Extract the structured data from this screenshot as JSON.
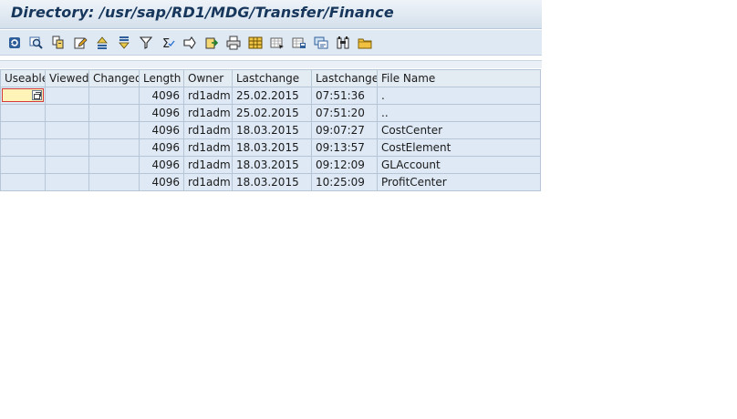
{
  "window": {
    "title": "Directory: /usr/sap/RD1/MDG/Transfer/Finance"
  },
  "toolbar": {
    "icons": [
      "refresh-icon",
      "zoom-icon",
      "copy-icon",
      "edit-icon",
      "sort-ascending-icon",
      "sort-descending-icon",
      "filter-icon",
      "total-icon",
      "subtotal-icon",
      "export-icon",
      "print-icon",
      "layout-icon",
      "select-layout-icon",
      "save-layout-icon",
      "abc-analysis-icon",
      "graphic-icon",
      "folder-icon"
    ]
  },
  "table": {
    "columns": [
      "Useable",
      "Viewed",
      "Changed",
      "Length",
      "Owner",
      "Lastchange",
      "Lastchange",
      "File Name"
    ],
    "rows": [
      {
        "useable": "",
        "viewed": "",
        "changed": "",
        "length": "4096",
        "owner": "rd1adm",
        "date": "25.02.2015",
        "time": "07:51:36",
        "file": "."
      },
      {
        "useable": "",
        "viewed": "",
        "changed": "",
        "length": "4096",
        "owner": "rd1adm",
        "date": "25.02.2015",
        "time": "07:51:20",
        "file": ".."
      },
      {
        "useable": "",
        "viewed": "",
        "changed": "",
        "length": "4096",
        "owner": "rd1adm",
        "date": "18.03.2015",
        "time": "09:07:27",
        "file": "CostCenter"
      },
      {
        "useable": "",
        "viewed": "",
        "changed": "",
        "length": "4096",
        "owner": "rd1adm",
        "date": "18.03.2015",
        "time": "09:13:57",
        "file": "CostElement"
      },
      {
        "useable": "",
        "viewed": "",
        "changed": "",
        "length": "4096",
        "owner": "rd1adm",
        "date": "18.03.2015",
        "time": "09:12:09",
        "file": "GLAccount"
      },
      {
        "useable": "",
        "viewed": "",
        "changed": "",
        "length": "4096",
        "owner": "rd1adm",
        "date": "18.03.2015",
        "time": "10:25:09",
        "file": "ProfitCenter"
      }
    ]
  },
  "colors": {
    "title_text": "#16365c",
    "toolbar_bg": "#dfe9f4",
    "cell_bg": "#dee9f5",
    "header_bg": "#e3ebf3",
    "grid_border": "#b7c6d6",
    "input_bg": "#fff3b8",
    "input_border": "#d63a3a"
  }
}
